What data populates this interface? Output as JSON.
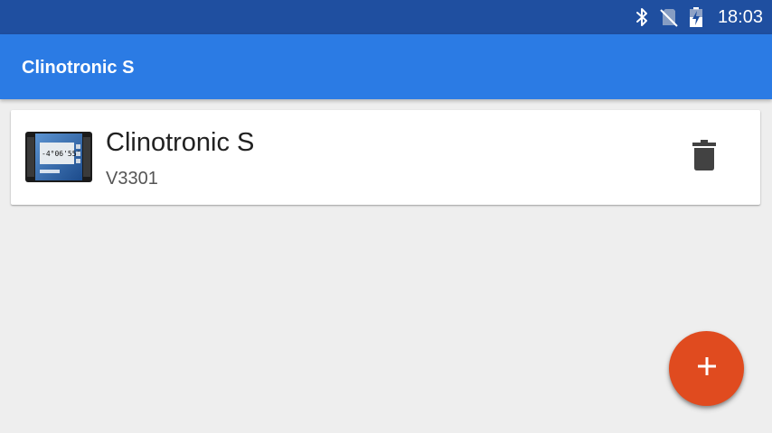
{
  "status_bar": {
    "time": "18:03",
    "icons": [
      "bluetooth-icon",
      "no-sim-icon",
      "battery-charging-icon"
    ],
    "background_color": "#1f4fa0"
  },
  "app_bar": {
    "title": "Clinotronic S",
    "background_color": "#2b7be4"
  },
  "devices": [
    {
      "name": "Clinotronic S",
      "serial": "V3301",
      "image_icon": "device-image",
      "action_icon": "trash-icon"
    }
  ],
  "fab": {
    "icon": "plus-icon",
    "color": "#e04b1f"
  }
}
